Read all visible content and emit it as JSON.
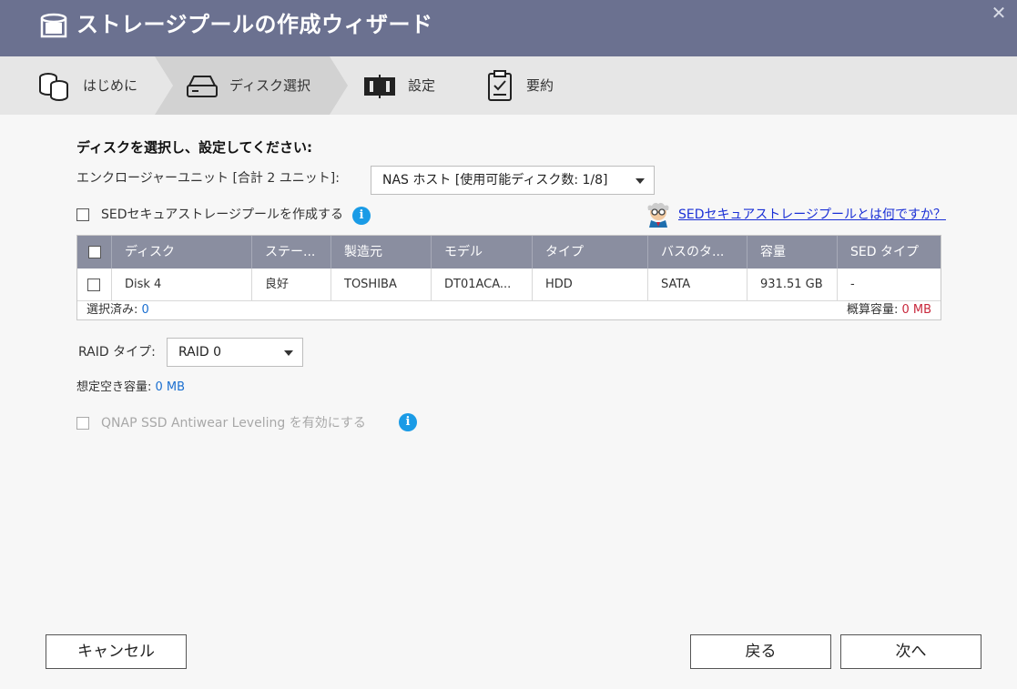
{
  "window": {
    "title": "ストレージプールの作成ウィザード",
    "close_glyph": "✕"
  },
  "steps": [
    {
      "label": "はじめに",
      "icon": "database-icon",
      "active": false
    },
    {
      "label": "ディスク選択",
      "icon": "hard-drive-icon",
      "active": true
    },
    {
      "label": "設定",
      "icon": "settings-drive-icon",
      "active": false
    },
    {
      "label": "要約",
      "icon": "clipboard-icon",
      "active": false
    }
  ],
  "main": {
    "heading": "ディスクを選択し、設定してください:",
    "enclosure_label": "エンクロージャーユニット [合計 2 ユニット]:",
    "enclosure_value": "NAS ホスト [使用可能ディスク数: 1/8]",
    "sed_checkbox_label": "SEDセキュアストレージプールを作成する",
    "sed_help_link": "SEDセキュアストレージプールとは何ですか？",
    "table": {
      "headers": [
        "ディスク",
        "ステー...",
        "製造元",
        "モデル",
        "タイプ",
        "バスのタ...",
        "容量",
        "SED タイプ"
      ],
      "rows": [
        [
          "Disk 4",
          "良好",
          "TOSHIBA",
          "DT01ACA...",
          "HDD",
          "SATA",
          "931.51 GB",
          "-"
        ]
      ],
      "selected_label": "選択済み: ",
      "selected_value": "0",
      "capacity_label": "概算容量: ",
      "capacity_value": "0 MB"
    },
    "raid_label": "RAID タイプ:",
    "raid_value": "RAID 0",
    "estimated_label": "想定空き容量: ",
    "estimated_value": "0 MB",
    "antiwear_label": "QNAP SSD Antiwear Leveling を有効にする"
  },
  "footer": {
    "cancel": "キャンセル",
    "back": "戻る",
    "next": "次へ"
  },
  "colors": {
    "titlebar": "#6b7190",
    "table_header": "#8a8ea0",
    "link": "#1a2fd6",
    "info": "#1a9be6",
    "value_blue": "#1a6fd0",
    "value_red": "#c8283c"
  }
}
